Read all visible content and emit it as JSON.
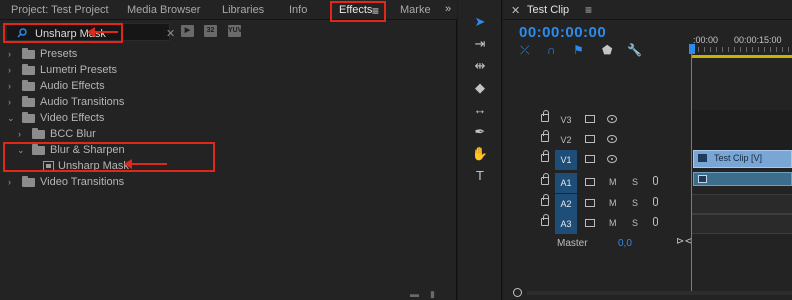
{
  "effects_panel": {
    "tabs": [
      {
        "label": "Project: Test Project"
      },
      {
        "label": "Media Browser"
      },
      {
        "label": "Libraries"
      },
      {
        "label": "Info"
      },
      {
        "label": "Effects",
        "active": true
      },
      {
        "label": "Marke"
      }
    ],
    "search": {
      "value": "Unsharp Mask",
      "placeholder": ""
    },
    "filter_buttons": [
      "accelerated-effects",
      "32-bit-color",
      "yuv-effects"
    ],
    "tree": [
      {
        "label": "Presets",
        "indent": 0,
        "expanded": false
      },
      {
        "label": "Lumetri Presets",
        "indent": 0,
        "expanded": false
      },
      {
        "label": "Audio Effects",
        "indent": 0,
        "expanded": false
      },
      {
        "label": "Audio Transitions",
        "indent": 0,
        "expanded": false
      },
      {
        "label": "Video Effects",
        "indent": 0,
        "expanded": true
      },
      {
        "label": "BCC Blur",
        "indent": 1,
        "expanded": false
      },
      {
        "label": "Blur & Sharpen",
        "indent": 1,
        "expanded": true
      },
      {
        "label": "Unsharp Mask",
        "indent": 2,
        "type": "effect"
      },
      {
        "label": "Video Transitions",
        "indent": 0,
        "expanded": false
      }
    ],
    "highlight_color": "#e0281a"
  },
  "tools": [
    "selection-tool",
    "track-select-tool",
    "ripple-edit-tool",
    "razor-tool",
    "slip-tool",
    "pen-tool",
    "hand-tool",
    "type-tool"
  ],
  "timeline": {
    "title": "Test Clip",
    "timecode": "00:00:00:00",
    "ruler": {
      "start": ":00:00",
      "mark": "00:00:15:00"
    },
    "video_tracks": [
      {
        "label": "V3",
        "selected": false
      },
      {
        "label": "V2",
        "selected": false
      },
      {
        "label": "V1",
        "selected": true
      }
    ],
    "audio_tracks": [
      {
        "label": "A1",
        "m": "M",
        "s": "S"
      },
      {
        "label": "A2",
        "m": "M",
        "s": "S"
      },
      {
        "label": "A3",
        "m": "M",
        "s": "S"
      }
    ],
    "clip": {
      "label": "Test Clip [V]",
      "fx": "fx"
    },
    "audio_clip": {
      "fx": "fx"
    },
    "master": {
      "label": "Master",
      "value": "0,0"
    },
    "accent_color": "#2d8ceb"
  }
}
